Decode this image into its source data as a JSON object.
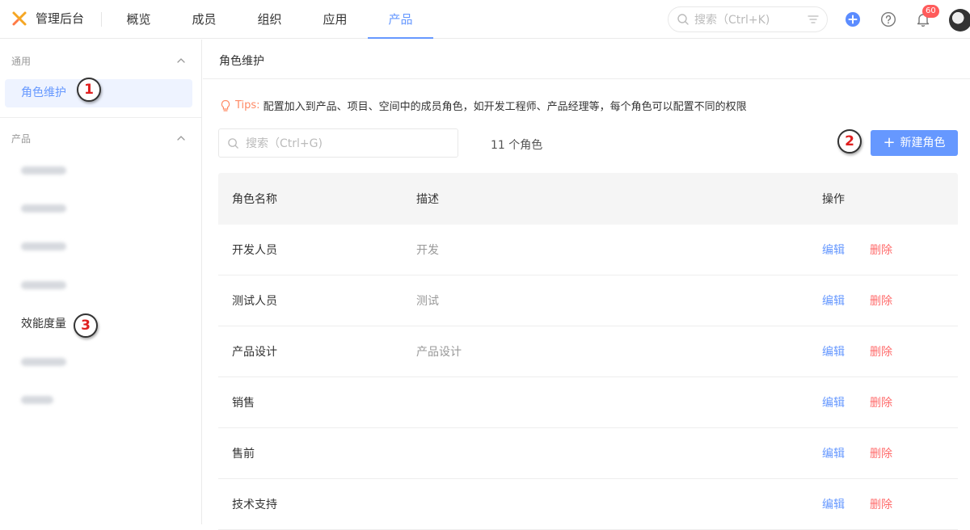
{
  "app": {
    "title": "管理后台"
  },
  "nav": {
    "items": [
      {
        "label": "概览"
      },
      {
        "label": "成员"
      },
      {
        "label": "组织"
      },
      {
        "label": "应用"
      },
      {
        "label": "产品"
      }
    ],
    "active_index": 4
  },
  "top_search": {
    "placeholder": "搜索（Ctrl+K)"
  },
  "notifications": {
    "count": "60"
  },
  "sidebar": {
    "group_general": {
      "label": "通用"
    },
    "active_item": {
      "label": "角色维护"
    },
    "group_product": {
      "label": "产品"
    },
    "visible_item": {
      "label": "效能度量"
    }
  },
  "markers": {
    "m1": "1",
    "m2": "2",
    "m3": "3"
  },
  "main": {
    "title": "角色维护",
    "tips_label": "Tips:",
    "tips_text": "配置加入到产品、项目、空间中的成员角色，如开发工程师、产品经理等，每个角色可以配置不同的权限",
    "search_placeholder": "搜索（Ctrl+G)",
    "count_text": "11 个角色",
    "new_button": "新建角色"
  },
  "table": {
    "headers": {
      "name": "角色名称",
      "desc": "描述",
      "op": "操作"
    },
    "edit_label": "编辑",
    "delete_label": "删除",
    "rows": [
      {
        "name": "开发人员",
        "desc": "开发"
      },
      {
        "name": "测试人员",
        "desc": "测试"
      },
      {
        "name": "产品设计",
        "desc": "产品设计"
      },
      {
        "name": "销售",
        "desc": ""
      },
      {
        "name": "售前",
        "desc": ""
      },
      {
        "name": "技术支持",
        "desc": ""
      }
    ]
  },
  "colors": {
    "accent": "#6698ff",
    "danger": "#ff6b6b",
    "tips": "#ff8a65",
    "brand": "#f5a623"
  }
}
